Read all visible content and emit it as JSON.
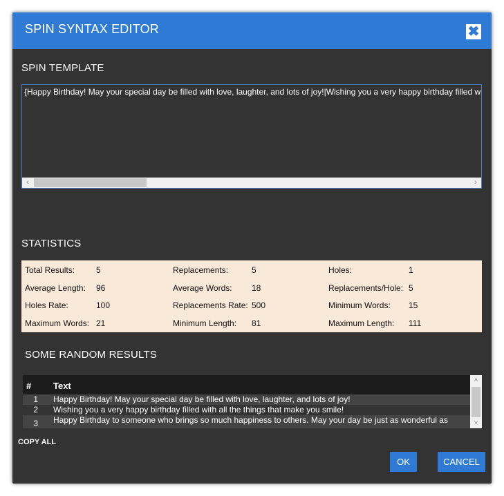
{
  "dialog": {
    "title": "SPIN SYNTAX EDITOR",
    "close_symbol": "✖"
  },
  "template": {
    "label": "SPIN TEMPLATE",
    "text": "{Happy Birthday! May your special day be filled with love, laughter, and lots of joy!|Wishing you a very happy birthday filled with all the things that make you smile!|Happy Birthday to someone who brings so much happiness to others. May your day be just as wonderful as you are!}"
  },
  "statistics": {
    "label": "STATISTICS",
    "items": [
      {
        "label": "Total Results:",
        "value": "5"
      },
      {
        "label": "Replacements:",
        "value": "5"
      },
      {
        "label": "Holes:",
        "value": "1"
      },
      {
        "label": "Average Length:",
        "value": "96"
      },
      {
        "label": "Average Words:",
        "value": "18"
      },
      {
        "label": "Replacements/Hole:",
        "value": "5"
      },
      {
        "label": "Holes Rate:",
        "value": "100"
      },
      {
        "label": "Replacements Rate:",
        "value": "500"
      },
      {
        "label": "Minimum Words:",
        "value": "15"
      },
      {
        "label": "Maximum Words:",
        "value": "21"
      },
      {
        "label": "Minimum Length:",
        "value": "81"
      },
      {
        "label": "Maximum Length:",
        "value": "111"
      }
    ]
  },
  "results": {
    "label": "SOME RANDOM RESULTS",
    "columns": [
      "#",
      "Text"
    ],
    "rows": [
      {
        "num": "1",
        "text": "Happy Birthday! May your special day be filled with love, laughter, and lots of joy!"
      },
      {
        "num": "2",
        "text": "Wishing you a very happy birthday filled with all the things that make you smile!"
      },
      {
        "num": "3",
        "text": "Happy Birthday to someone who brings so much happiness to others. May your day be just as wonderful as"
      }
    ]
  },
  "actions": {
    "copy_all": "COPY ALL",
    "ok": "OK",
    "cancel": "CANCEL"
  },
  "colors": {
    "accent": "#2f7ad4",
    "background": "#333333",
    "stats_background": "#f9e9d8"
  }
}
